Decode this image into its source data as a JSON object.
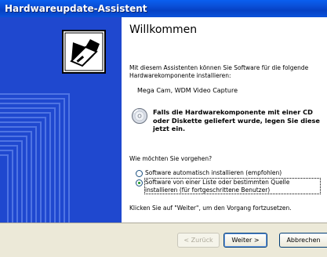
{
  "window": {
    "title": "Hardwareupdate-Assistent"
  },
  "welcome": {
    "heading": "Willkommen",
    "intro": "Mit diesem Assistenten können Sie Software für die folgende Hardwarekomponente installieren:",
    "device": "Mega Cam, WDM Video Capture",
    "cd_notice": "Falls die Hardwarekomponente mit einer CD oder Diskette geliefert wurde, legen Sie diese jetzt ein.",
    "question": "Wie möchten Sie vorgehen?",
    "options": [
      {
        "label": "Software automatisch installieren (empfohlen)",
        "selected": false
      },
      {
        "label": "Software von einer Liste oder bestimmten Quelle installieren (für fortgeschrittene Benutzer)",
        "selected": true
      }
    ],
    "continue_hint": "Klicken Sie auf \"Weiter\", um den Vorgang fortzusetzen."
  },
  "buttons": {
    "back": "< Zurück",
    "next": "Weiter >",
    "cancel": "Abbrechen"
  }
}
